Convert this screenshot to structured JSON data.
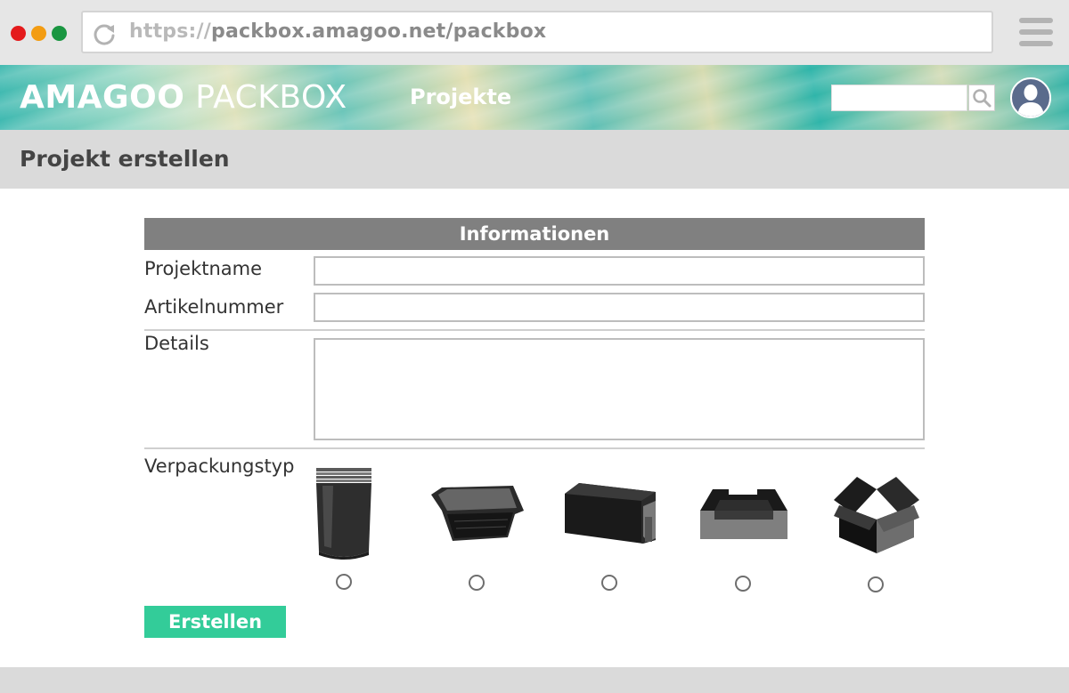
{
  "browser": {
    "url_protocol": "https://",
    "url_rest": "packbox.amagoo.net/packbox",
    "icons": {
      "reload": "reload-icon",
      "menu": "hamburger-menu-icon"
    }
  },
  "header": {
    "logo_bold": "AMAGOO",
    "logo_light": " PACKBOX",
    "nav_item": "Projekte",
    "search_placeholder": "",
    "icons": {
      "search": "search-icon",
      "avatar": "user-avatar-icon"
    }
  },
  "page": {
    "title": "Projekt erstellen"
  },
  "form": {
    "section_title": "Informationen",
    "fields": {
      "projektname": {
        "label": "Projektname",
        "value": ""
      },
      "artikelnummer": {
        "label": "Artikelnummer",
        "value": ""
      },
      "details": {
        "label": "Details",
        "value": ""
      }
    },
    "packaging": {
      "label": "Verpackungstyp",
      "options": [
        {
          "icon": "pouch-icon",
          "selected": false
        },
        {
          "icon": "tray-icon",
          "selected": false
        },
        {
          "icon": "sleeve-box-icon",
          "selected": false
        },
        {
          "icon": "display-box-icon",
          "selected": false
        },
        {
          "icon": "open-carton-icon",
          "selected": false
        }
      ]
    },
    "submit_label": "Erstellen"
  },
  "colors": {
    "accent": "#33cc99",
    "section_header": "#808080",
    "title_bar": "#dadada"
  }
}
